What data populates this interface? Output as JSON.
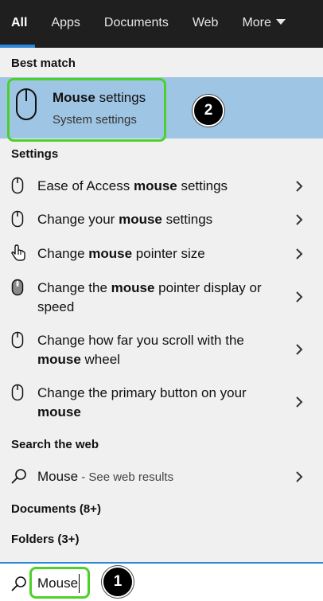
{
  "tabs": [
    {
      "label": "All"
    },
    {
      "label": "Apps"
    },
    {
      "label": "Documents"
    },
    {
      "label": "Web"
    },
    {
      "label": "More"
    }
  ],
  "best_match": {
    "heading": "Best match",
    "title_bold": "Mouse",
    "title_rest": " settings",
    "subtitle": "System settings",
    "callout": "2"
  },
  "settings": {
    "heading": "Settings",
    "items": [
      {
        "pre": "Ease of Access ",
        "bold": "mouse",
        "post": " settings",
        "icon": "mouse-icon"
      },
      {
        "pre": "Change your ",
        "bold": "mouse",
        "post": " settings",
        "icon": "mouse-icon"
      },
      {
        "pre": "Change ",
        "bold": "mouse",
        "post": " pointer size",
        "icon": "hand-pointer-icon"
      },
      {
        "pre": "Change the ",
        "bold": "mouse",
        "post": " pointer display or speed",
        "icon": "mouse-filled-icon"
      },
      {
        "pre": "Change how far you scroll with the ",
        "bold": "mouse",
        "post": " wheel",
        "icon": "mouse-icon"
      },
      {
        "pre": "Change the primary button on your ",
        "bold": "mouse",
        "post": "",
        "icon": "mouse-icon"
      }
    ]
  },
  "web": {
    "heading": "Search the web",
    "query": "Mouse",
    "suffix": " - See web results"
  },
  "documents_label": "Documents (8+)",
  "folders_label": "Folders (3+)",
  "search": {
    "value": "Mouse",
    "callout": "1"
  },
  "colors": {
    "accent": "#2b88d8",
    "highlight_box": "#4cd12b",
    "selected_row": "#9fc5e4"
  }
}
